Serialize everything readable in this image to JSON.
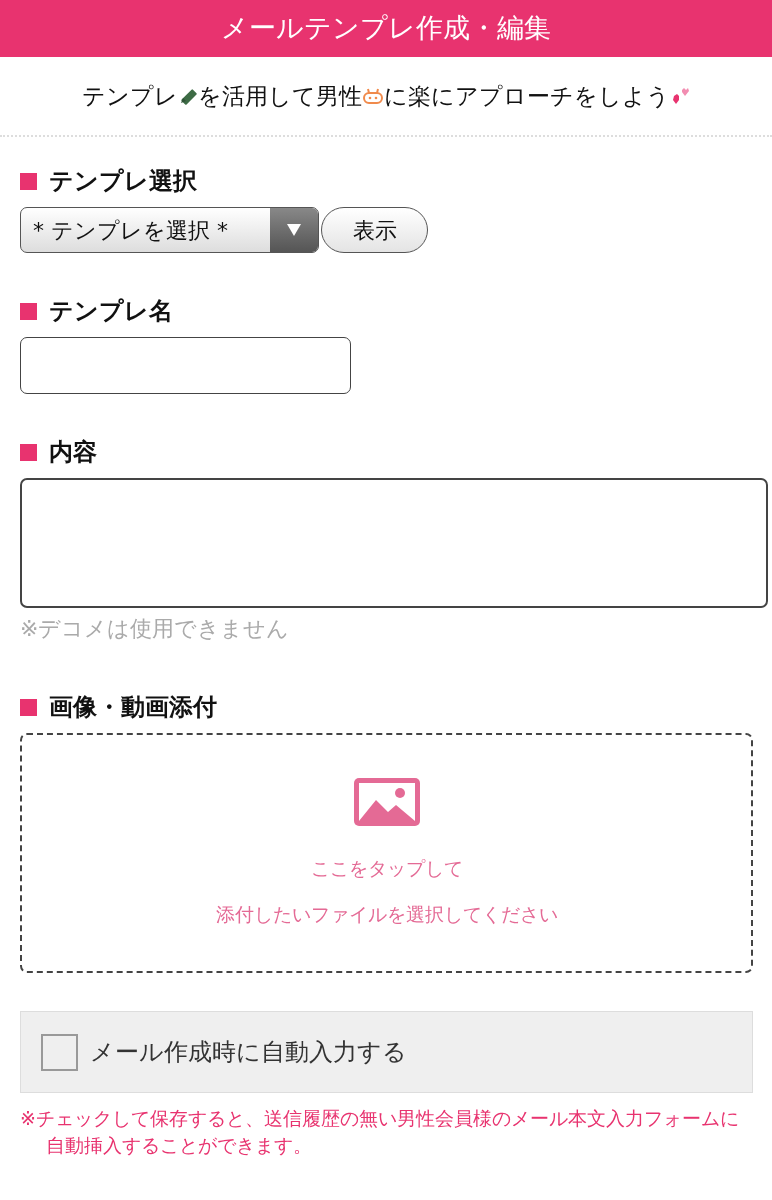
{
  "header": {
    "title": "メールテンプレ作成・編集"
  },
  "subtitle": {
    "parts": [
      "テンプレ",
      "を活用して男性",
      "に楽にアプローチをしよう"
    ]
  },
  "template_select": {
    "label": "テンプレ選択",
    "value": "* テンプレを選択 *",
    "button": "表示"
  },
  "template_name": {
    "label": "テンプレ名"
  },
  "content": {
    "label": "内容",
    "note": "※デコメは使用できません"
  },
  "attachment": {
    "label": "画像・動画添付",
    "lines": [
      "ここをタップして",
      "添付したいファイルを選択してください"
    ]
  },
  "auto_input": {
    "label": "メール作成時に自動入力する",
    "checked": false
  },
  "auto_note": "※チェックして保存すると、送信履歴の無い男性会員様のメール本文入力フォームに自動挿入することができます。"
}
